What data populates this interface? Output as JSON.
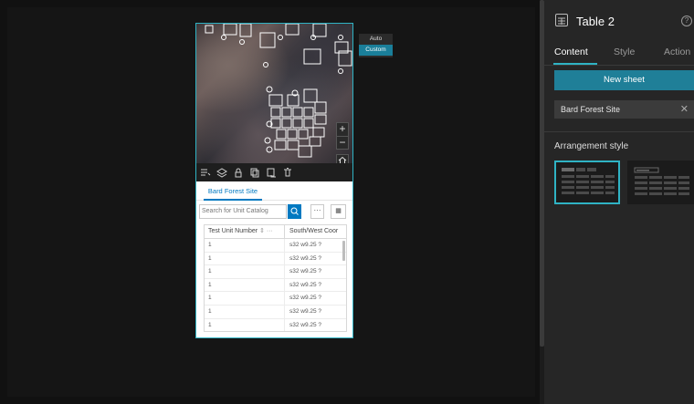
{
  "popup": {
    "options": [
      "Auto",
      "Custom"
    ],
    "selected": "Custom"
  },
  "widget": {
    "tab_label": "Bard Forest Site",
    "search_placeholder": "Search for Unit Catalog",
    "more_icon": "ellipsis-icon",
    "grid_icon": "grid-icon",
    "table": {
      "columns": [
        "Test Unit Number",
        "South/West Coor"
      ],
      "rows": [
        [
          "1",
          "s32 w9.25 ?"
        ],
        [
          "1",
          "s32 w9.25 ?"
        ],
        [
          "1",
          "s32 w9.25 ?"
        ],
        [
          "1",
          "s32 w9.25 ?"
        ],
        [
          "1",
          "s32 w9.25 ?"
        ],
        [
          "1",
          "s32 w9.25 ?"
        ],
        [
          "1",
          "s32 w9.25 ?"
        ]
      ]
    }
  },
  "panel": {
    "title": "Table 2",
    "tabs": [
      "Content",
      "Style",
      "Action"
    ],
    "active_tab": "Content",
    "new_sheet_label": "New sheet",
    "sheet_name": "Bard Forest Site",
    "arrangement_label": "Arrangement style",
    "accent": "#2fb3c4",
    "button_color": "#1f7f98"
  }
}
